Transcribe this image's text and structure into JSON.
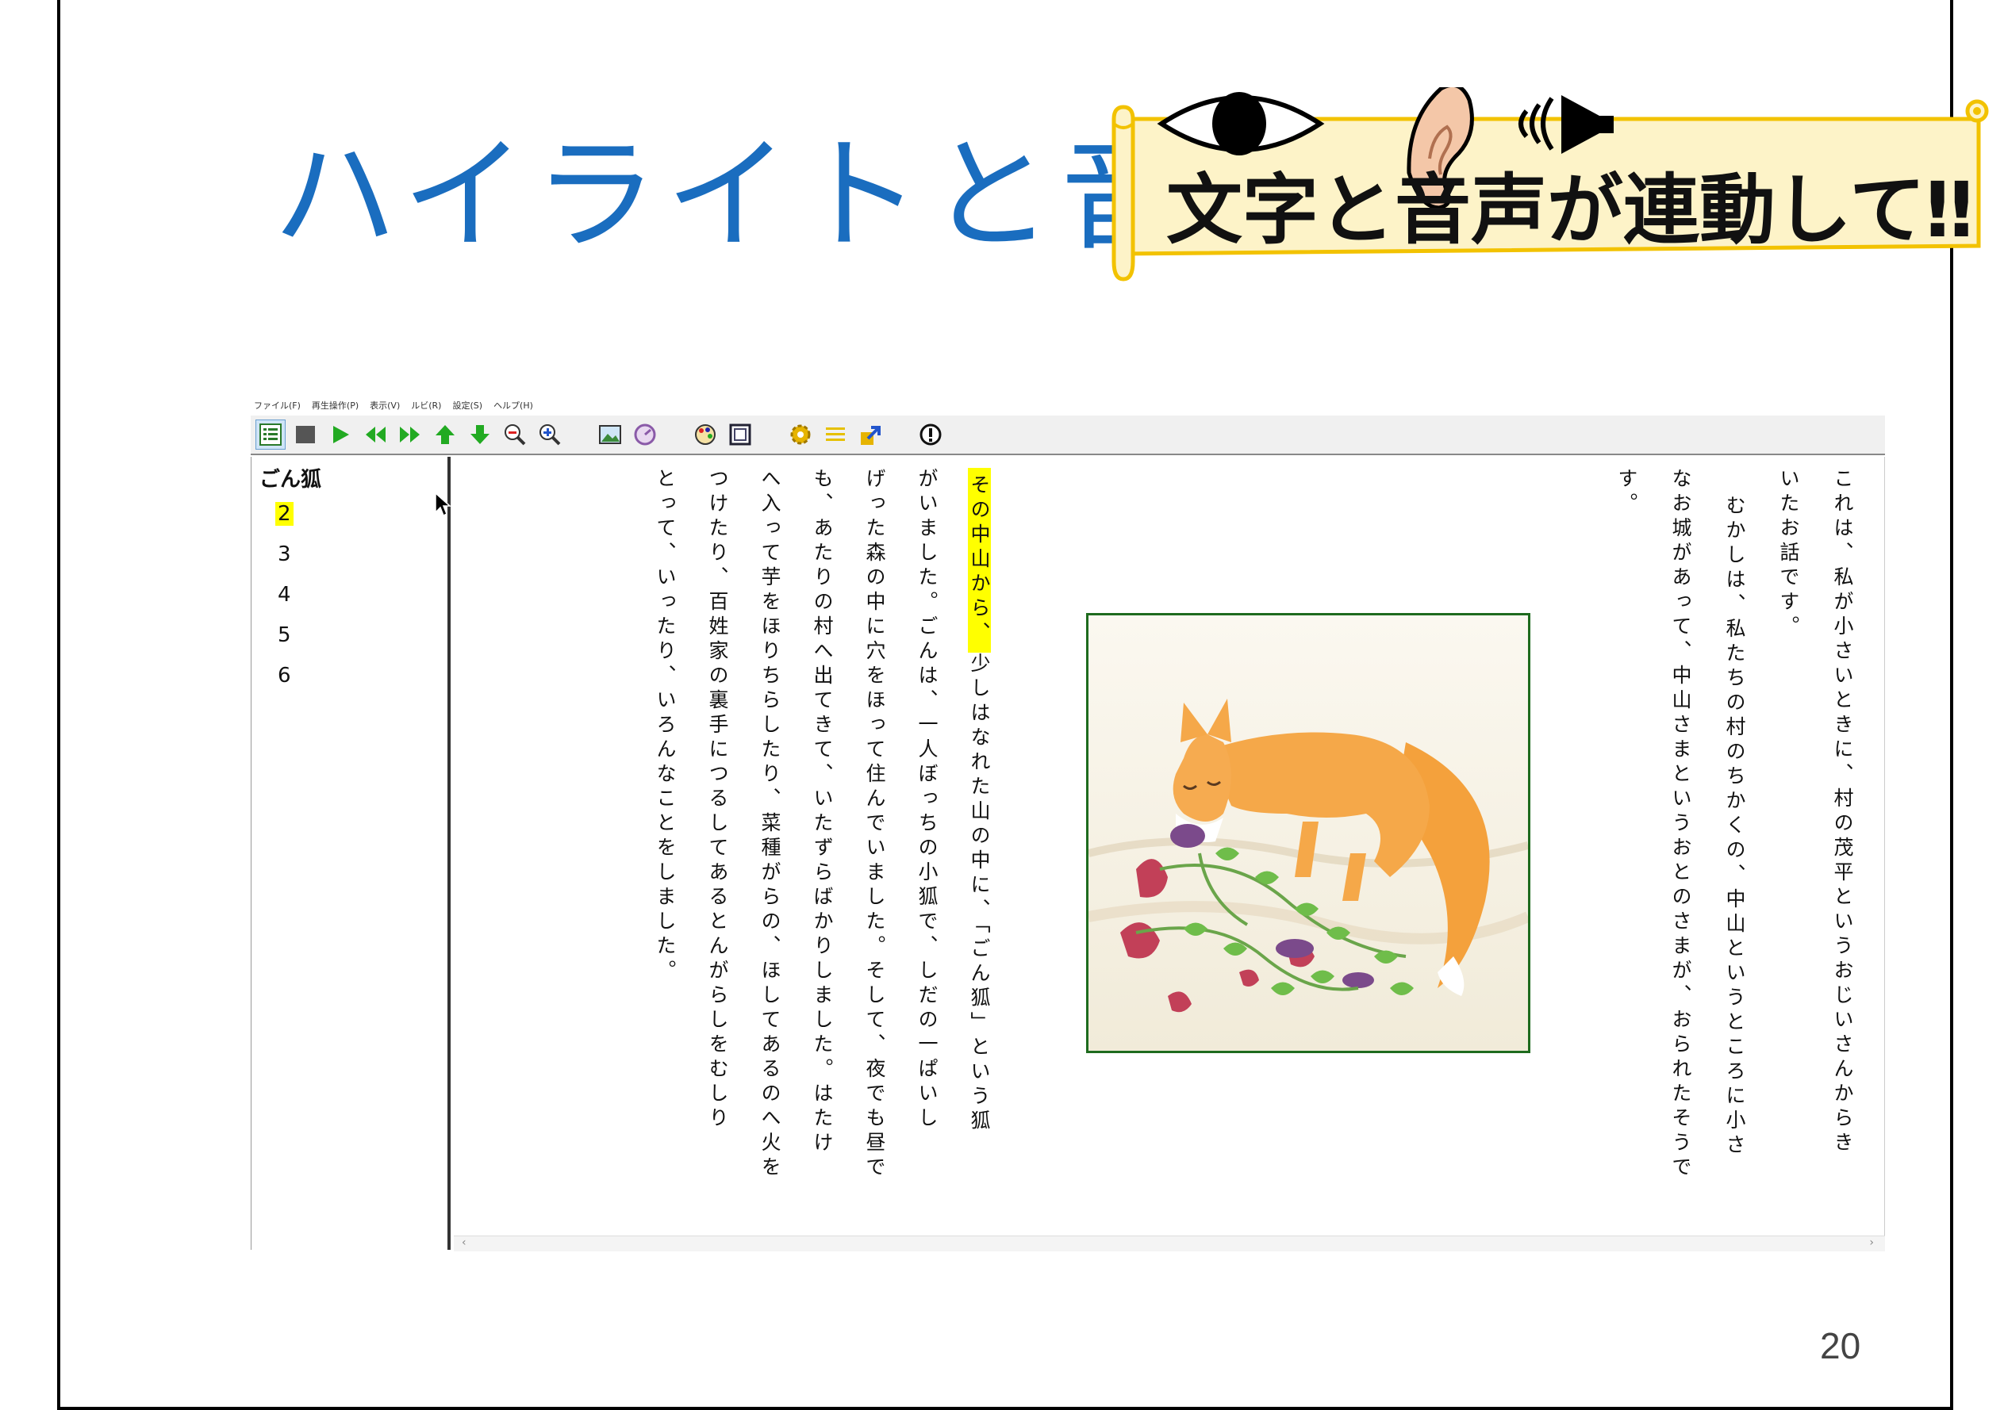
{
  "slide": {
    "title": "ハイライトと音",
    "banner_text": "文字と音声が連動して‼",
    "page_number": "20"
  },
  "app": {
    "menu": [
      "ファイル(F)",
      "再生操作(P)",
      "表示(V)",
      "ルビ(R)",
      "設定(S)",
      "ヘルプ(H)"
    ],
    "toolbar_icons": [
      "toc-icon",
      "stop-icon",
      "play-icon",
      "rewind-icon",
      "fast-forward-icon",
      "up-arrow-icon",
      "down-arrow-icon",
      "zoom-out-icon",
      "zoom-in-icon",
      "image-icon",
      "speed-icon",
      "palette-icon",
      "frame-icon",
      "settings-icon",
      "lines-icon",
      "export-icon",
      "info-icon"
    ],
    "toolbar_active": "toc-icon",
    "sidebar": {
      "title": "ごん狐",
      "items": [
        "2",
        "3",
        "4",
        "5",
        "6"
      ],
      "current": "2"
    },
    "text_columns": [
      "これは、私が小さいときに、村の茂平というおじいさんからき",
      "いたお話です。",
      "むかしは、私たちの村のちかくの、中山というところに小さ",
      "なお城があって、中山さまというおとのさまが、おられたそうで",
      "す。",
      "少しはなれた山の中に、「ごん狐」という狐",
      "がいました。ごんは、一人ぼっちの小狐で、しだの一ぱいし",
      "げった森の中に穴をほって住んでいました。そして、夜でも昼で",
      "も、あたりの村へ出てきて、いたずらばかりしました。はたけ",
      "へ入って芋をほりちらしたり、菜種がらの、ほしてあるのへ火を",
      "つけたり、百姓家の裏手につるしてあるとんがらしをむしり",
      "とって、いったり、いろんなことをしました。"
    ],
    "highlight_text": "その中山から、"
  },
  "colors": {
    "title_blue": "#1a6dbf",
    "highlight": "#ffff00",
    "banner_fill": "#fdf3c8",
    "banner_stroke": "#f2c200"
  }
}
